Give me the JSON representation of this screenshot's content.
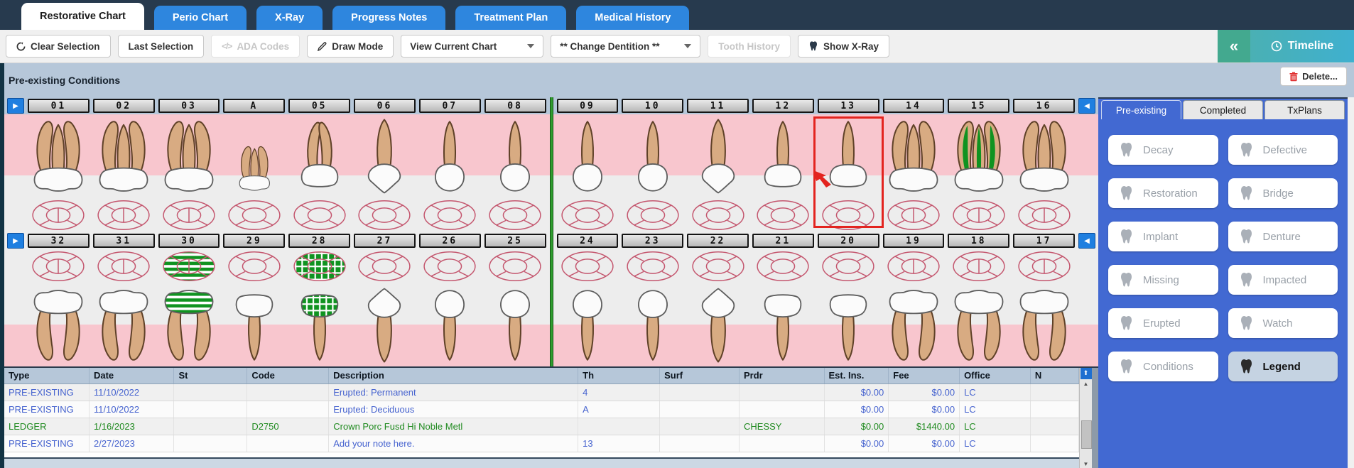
{
  "colors": {
    "navy": "#273a4e",
    "tab_blue": "#2e86de",
    "teal": "#43a98f",
    "teal2": "#3fb0cf",
    "band": "#b6c7d9",
    "pink": "#f8c6ce",
    "light_zone": "#ededed",
    "sidebar_blue": "#4269d2",
    "selection_red": "#e3241f",
    "green_marking": "#0f9320",
    "link_blue": "#4663cf",
    "ledger_green": "#1f8a1f"
  },
  "tab_bar": {
    "tabs": [
      {
        "label": "Restorative Chart",
        "active": true
      },
      {
        "label": "Perio Chart",
        "active": false
      },
      {
        "label": "X-Ray",
        "active": false
      },
      {
        "label": "Progress Notes",
        "active": false
      },
      {
        "label": "Treatment Plan",
        "active": false
      },
      {
        "label": "Medical History",
        "active": false
      }
    ]
  },
  "toolbar": {
    "clear_selection": "Clear Selection",
    "last_selection": "Last Selection",
    "ada_codes": "ADA Codes",
    "ada_glyph": "</>",
    "draw_mode": "Draw Mode",
    "view_chart": "View Current Chart",
    "change_dentition": "** Change Dentition **",
    "tooth_history": "Tooth History",
    "show_xray": "Show X-Ray",
    "collapse": "«",
    "timeline": "Timeline"
  },
  "section": {
    "title": "Pre-existing Conditions",
    "delete_label": "Delete..."
  },
  "chart": {
    "nav_right": "▶",
    "nav_left": "◀",
    "upper_numbers": [
      "01",
      "02",
      "03",
      "A",
      "05",
      "06",
      "07",
      "08",
      "09",
      "10",
      "11",
      "12",
      "13",
      "14",
      "15",
      "16"
    ],
    "lower_numbers": [
      "32",
      "31",
      "30",
      "29",
      "28",
      "27",
      "26",
      "25",
      "24",
      "23",
      "22",
      "21",
      "20",
      "19",
      "18",
      "17"
    ],
    "upper_kinds": [
      "molar3",
      "molar3",
      "molar3",
      "molarA",
      "premolar2",
      "canine",
      "incisor",
      "incisor",
      "incisor",
      "incisor",
      "canine",
      "premolar1",
      "premolar1",
      "molar3",
      "molar3canal",
      "molar3"
    ],
    "lower_kinds": [
      "molar2",
      "molar2",
      "molar2stripe",
      "premolar1",
      "premolar1check",
      "canine",
      "incisor",
      "incisor",
      "incisor",
      "incisor",
      "canine",
      "premolar1",
      "premolar1",
      "molar2",
      "molar2",
      "molar2"
    ],
    "selection": {
      "tooth": "13"
    }
  },
  "sidebar": {
    "tabs": [
      {
        "label": "Pre-existing",
        "active": true
      },
      {
        "label": "Completed",
        "active": false
      },
      {
        "label": "TxPlans",
        "active": false
      }
    ],
    "buttons": [
      {
        "label": "Decay"
      },
      {
        "label": "Defective"
      },
      {
        "label": "Restoration"
      },
      {
        "label": "Bridge"
      },
      {
        "label": "Implant"
      },
      {
        "label": "Denture"
      },
      {
        "label": "Missing"
      },
      {
        "label": "Impacted"
      },
      {
        "label": "Erupted"
      },
      {
        "label": "Watch"
      },
      {
        "label": "Conditions"
      },
      {
        "label": "Legend",
        "legend": true
      }
    ]
  },
  "table": {
    "columns": [
      "Type",
      "Date",
      "St",
      "Code",
      "Description",
      "Th",
      "Surf",
      "Prdr",
      "Est. Ins.",
      "Fee",
      "Office",
      "N"
    ],
    "scroll_up": "▲",
    "scroll_down": "▼",
    "expand": "⬆",
    "rows": [
      {
        "type": "PRE-EXISTING",
        "date": "11/10/2022",
        "st": "",
        "code": "",
        "description": "Erupted:  Permanent",
        "th": "4",
        "surf": "",
        "prdr": "",
        "est_ins": "$0.00",
        "fee": "$0.00",
        "office": "LC",
        "n": "",
        "color": "blue"
      },
      {
        "type": "PRE-EXISTING",
        "date": "11/10/2022",
        "st": "",
        "code": "",
        "description": "Erupted:  Deciduous",
        "th": "A",
        "surf": "",
        "prdr": "",
        "est_ins": "$0.00",
        "fee": "$0.00",
        "office": "LC",
        "n": "",
        "color": "blue"
      },
      {
        "type": "LEDGER",
        "date": "1/16/2023",
        "st": "",
        "code": "D2750",
        "description": "Crown Porc Fusd Hi Noble Metl",
        "th": "",
        "surf": "",
        "prdr": "CHESSY",
        "est_ins": "$0.00",
        "fee": "$1440.00",
        "office": "LC",
        "n": "",
        "color": "green"
      },
      {
        "type": "PRE-EXISTING",
        "date": "2/27/2023",
        "st": "",
        "code": "",
        "description": "Add your note here.",
        "th": "13",
        "surf": "",
        "prdr": "",
        "est_ins": "$0.00",
        "fee": "$0.00",
        "office": "LC",
        "n": "",
        "color": "blue"
      }
    ]
  }
}
